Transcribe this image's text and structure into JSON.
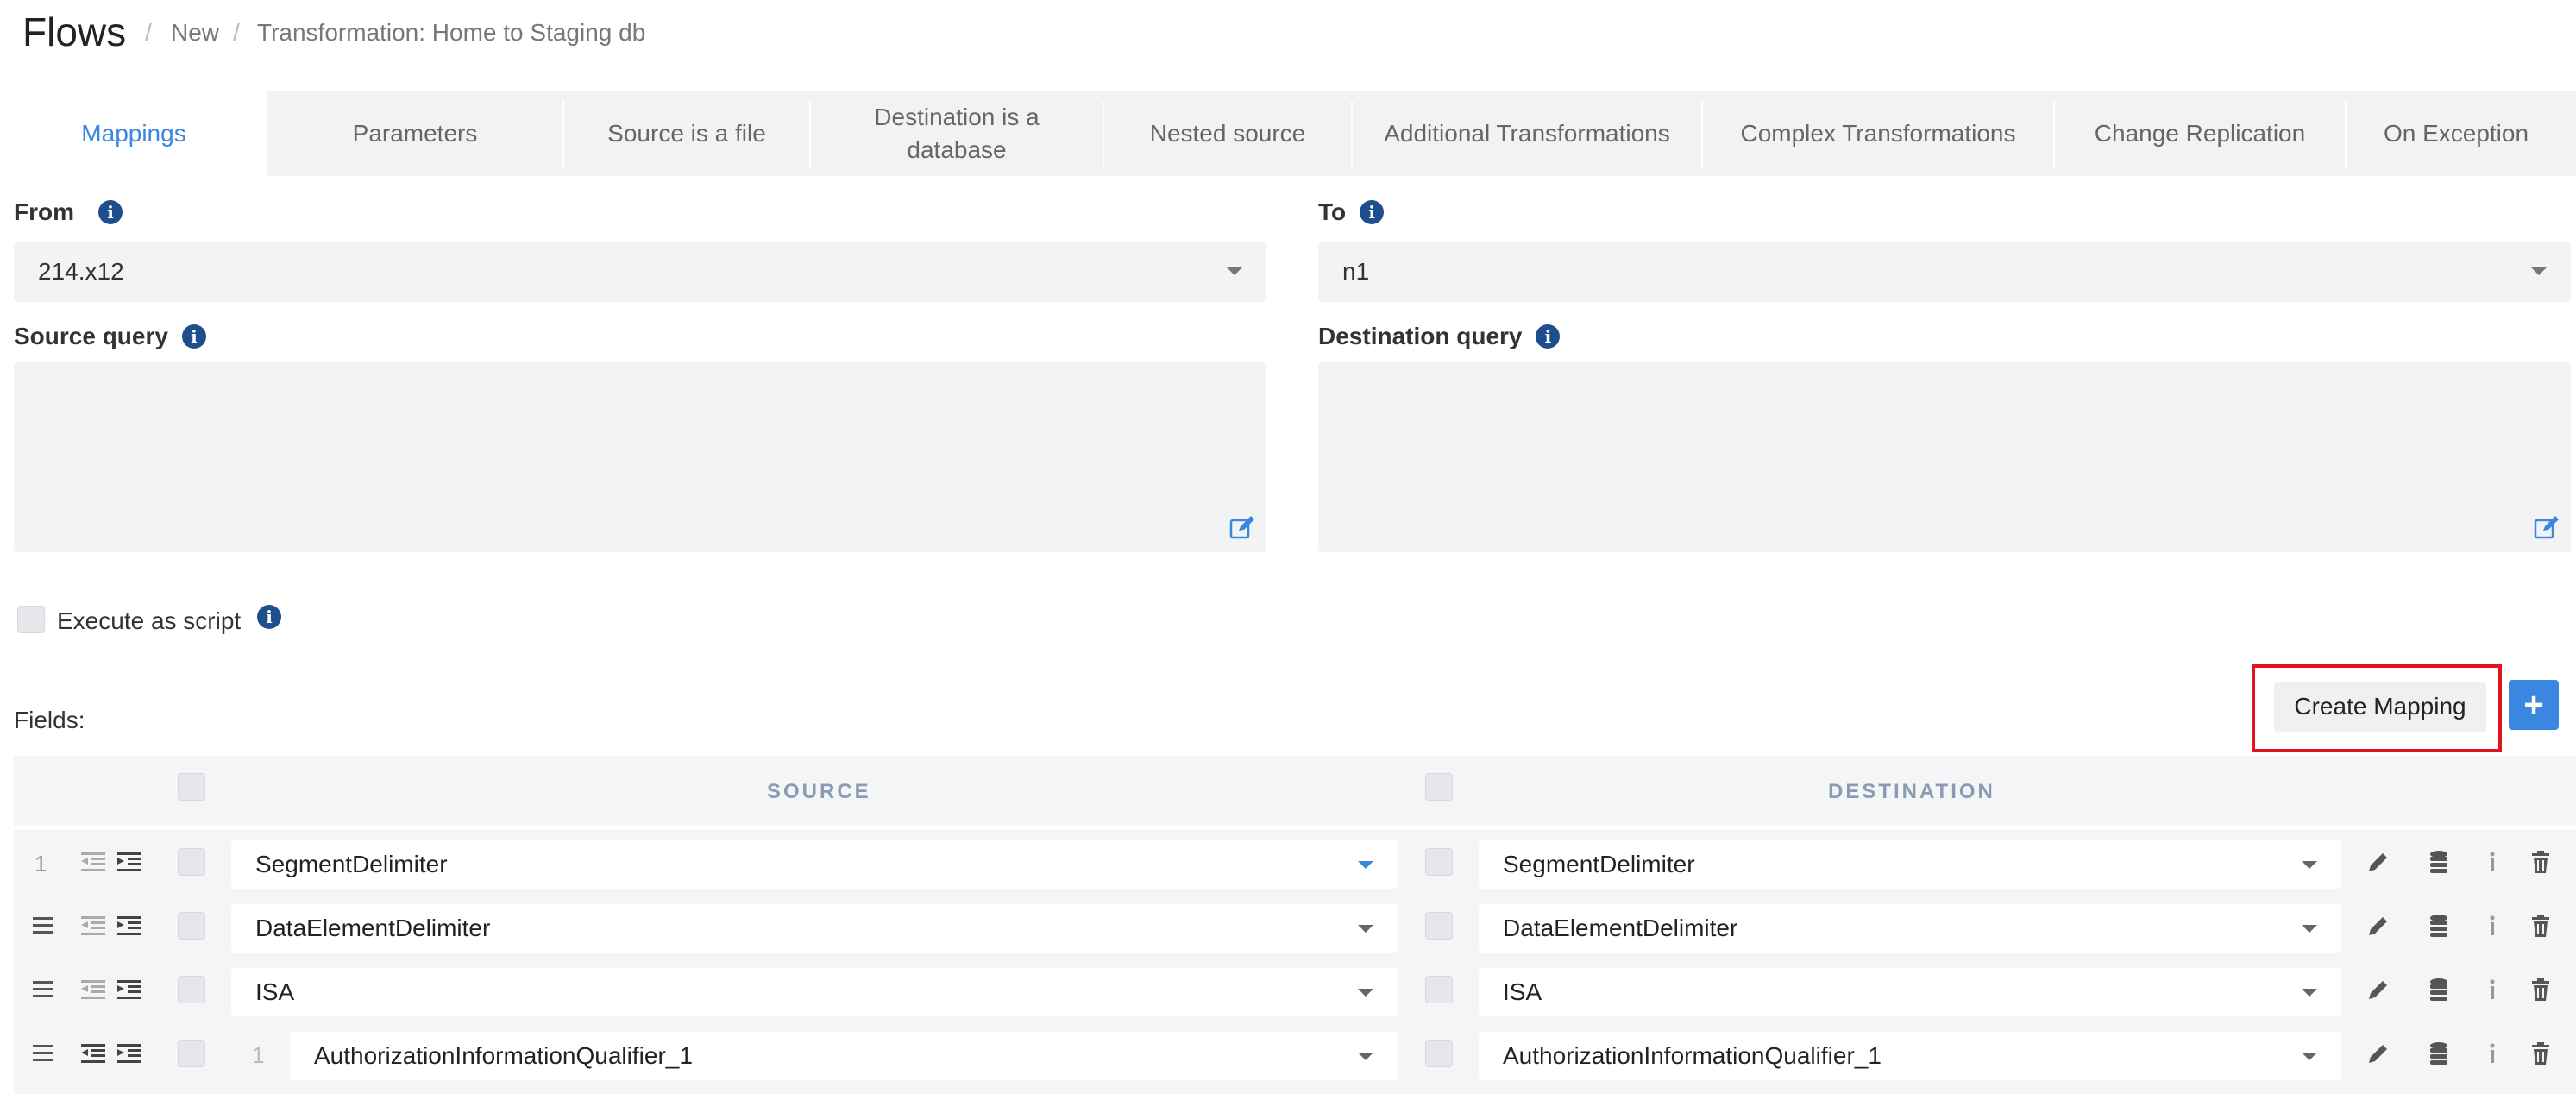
{
  "header": {
    "title": "Flows",
    "breadcrumb": [
      "New",
      "Transformation: Home to Staging db"
    ]
  },
  "tabs": [
    {
      "label": "Mappings",
      "active": true
    },
    {
      "label": "Parameters"
    },
    {
      "label": "Source is a file"
    },
    {
      "label": "Destination is a database"
    },
    {
      "label": "Nested source"
    },
    {
      "label": "Additional Transformations"
    },
    {
      "label": "Complex Transformations"
    },
    {
      "label": "Change Replication"
    },
    {
      "label": "On Exception"
    }
  ],
  "from": {
    "label": "From",
    "value": "214.x12"
  },
  "to": {
    "label": "To",
    "value": "n1"
  },
  "source_query": {
    "label": "Source query"
  },
  "destination_query": {
    "label": "Destination query"
  },
  "execute_as_script": {
    "label": "Execute as script",
    "checked": false
  },
  "fields": {
    "label": "Fields:",
    "create_mapping": "Create Mapping",
    "add_symbol": "+",
    "columns": {
      "source": "SOURCE",
      "destination": "DESTINATION"
    },
    "rows": [
      {
        "num": "1",
        "source": "SegmentDelimiter",
        "destination": "SegmentDelimiter"
      },
      {
        "num": "",
        "source": "DataElementDelimiter",
        "destination": "DataElementDelimiter"
      },
      {
        "num": "",
        "source": "ISA",
        "destination": "ISA"
      },
      {
        "num": "",
        "sub_num": "1",
        "source": "AuthorizationInformationQualifier_1",
        "destination": "AuthorizationInformationQualifier_1"
      }
    ]
  },
  "colors": {
    "accent": "#3a86e0",
    "highlight": "#e0141e",
    "info": "#1f4e8c"
  }
}
